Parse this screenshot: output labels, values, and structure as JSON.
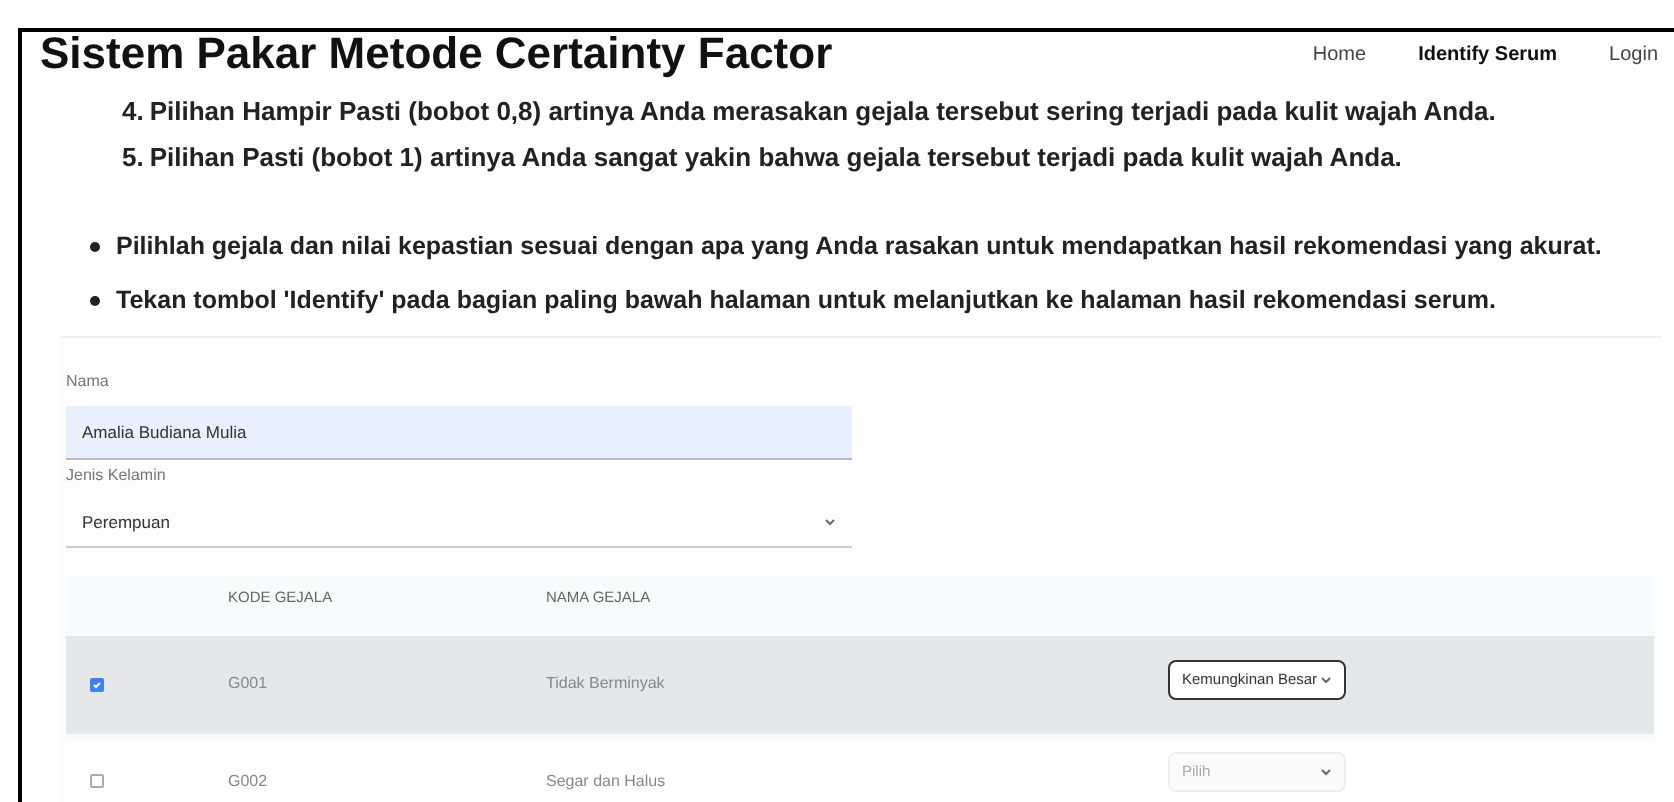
{
  "header": {
    "title": "Sistem Pakar Metode Certainty Factor",
    "nav": [
      {
        "label": "Home",
        "selected": false
      },
      {
        "label": "Identify Serum",
        "selected": true
      },
      {
        "label": "Login",
        "selected": false
      }
    ]
  },
  "instructions": [
    {
      "number": "4.",
      "text": "Pilihan Hampir Pasti (bobot 0,8) artinya Anda merasakan gejala tersebut sering terjadi pada kulit wajah Anda."
    },
    {
      "number": "5.",
      "text": "Pilihan Pasti (bobot 1) artinya Anda sangat yakin bahwa gejala tersebut terjadi pada kulit wajah Anda."
    }
  ],
  "notes": [
    "Pilihlah gejala dan nilai kepastian sesuai dengan apa yang Anda rasakan untuk mendapatkan hasil rekomendasi yang akurat.",
    "Tekan tombol 'Identify' pada bagian paling bawah halaman untuk melanjutkan ke halaman hasil rekomendasi serum."
  ],
  "form": {
    "name": {
      "label": "Nama",
      "value": "Amalia Budiana Mulia"
    },
    "gender": {
      "label": "Jenis Kelamin",
      "value": "Perempuan"
    }
  },
  "table": {
    "columns": [
      "KODE GEJALA",
      "NAMA GEJALA"
    ],
    "rows": [
      {
        "checked": true,
        "code": "G001",
        "name": "Tidak Berminyak",
        "choice": "Kemungkinan Besar",
        "disabled": false
      },
      {
        "checked": false,
        "code": "G002",
        "name": "Segar dan Halus",
        "choice": "Pilih",
        "disabled": true
      }
    ]
  }
}
